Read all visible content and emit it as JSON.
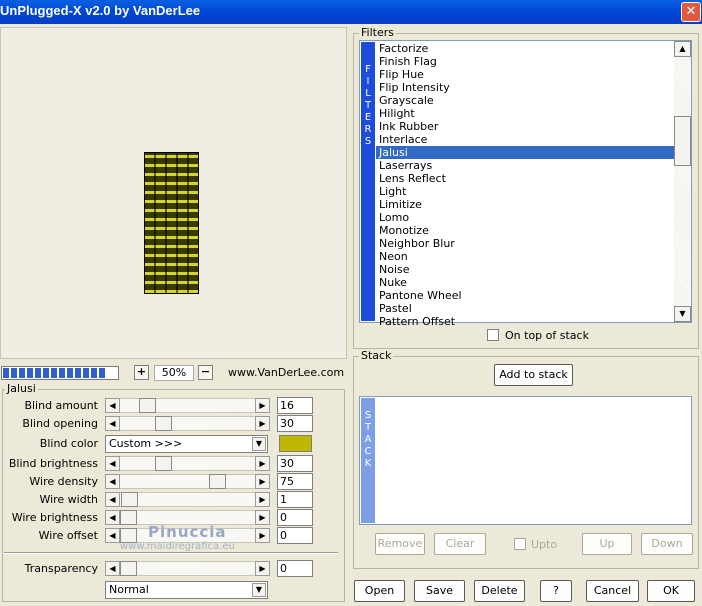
{
  "window": {
    "title": "UnPlugged-X v2.0 by VanDerLee",
    "close_glyph": "✕"
  },
  "preview": {
    "zoom_minus": "−",
    "zoom_plus": "+",
    "zoom_value": "50%",
    "website": "www.VanDerLee.com",
    "progress_segments": 13
  },
  "params": {
    "group_label": "Jalusi",
    "rows": [
      {
        "label": "Blind amount",
        "value": "16",
        "position": 0.16
      },
      {
        "label": "Blind opening",
        "value": "30",
        "position": 0.3
      },
      {
        "label": "Blind brightness",
        "value": "30",
        "position": 0.3
      },
      {
        "label": "Wire density",
        "value": "75",
        "position": 0.75
      },
      {
        "label": "Wire width",
        "value": "1",
        "position": 0.01
      },
      {
        "label": "Wire brightness",
        "value": "0",
        "position": 0.0
      },
      {
        "label": "Wire offset",
        "value": "0",
        "position": 0.0
      }
    ],
    "blind_color": {
      "label": "Blind color",
      "selected": "Custom >>>",
      "swatch": "#c0b800"
    },
    "transparency": {
      "label": "Transparency",
      "value": "0",
      "position": 0.0
    },
    "blend_mode": "Normal"
  },
  "filters": {
    "group_label": "Filters",
    "band_letters": [
      "F",
      "I",
      "L",
      "T",
      "E",
      "R",
      "S"
    ],
    "items": [
      "Factorize",
      "Finish Flag",
      "Flip Hue",
      "Flip Intensity",
      "Grayscale",
      "Hilight",
      "Ink Rubber",
      "Interlace",
      "Jalusi",
      "Laserrays",
      "Lens Reflect",
      "Light",
      "Limitize",
      "Lomo",
      "Monotize",
      "Neighbor Blur",
      "Neon",
      "Noise",
      "Nuke",
      "Pantone Wheel",
      "Pastel",
      "Pattern Offset"
    ],
    "selected": "Jalusi",
    "on_top_label": "On top of stack",
    "accent": "#316ac5"
  },
  "stack": {
    "group_label": "Stack",
    "add_label": "Add to stack",
    "band_letters": [
      "S",
      "T",
      "A",
      "C",
      "K"
    ],
    "remove_label": "Remove",
    "clear_label": "Clear",
    "upto_label": "Upto",
    "up_label": "Up",
    "down_label": "Down"
  },
  "buttons": {
    "open": "Open",
    "save": "Save",
    "delete": "Delete",
    "help": "?",
    "cancel": "Cancel",
    "ok": "OK"
  },
  "watermark": {
    "name": "Pinuccia",
    "url": "www.maidiregrafica.eu"
  }
}
